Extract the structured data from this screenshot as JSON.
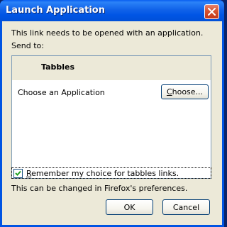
{
  "window": {
    "title": "Launch Application"
  },
  "message": "This link needs to be opened with an application.",
  "send_to_label": "Send to:",
  "handler": {
    "name": "Tabbles",
    "choose_app_label": "Choose an Application",
    "choose_button": {
      "before": "",
      "mnemonic": "C",
      "after": "hoose..."
    }
  },
  "remember": {
    "checked": true,
    "before": "",
    "mnemonic": "R",
    "after": "emember my choice for tabbles links."
  },
  "hint": "This can be changed in Firefox's preferences.",
  "buttons": {
    "ok": "OK",
    "cancel": "Cancel"
  },
  "colors": {
    "titlebar": "#0054e3",
    "dialog_bg": "#ece9d8",
    "close_button": "#d6522f",
    "check_mark": "#21a121"
  },
  "icons": {
    "close": "close-icon",
    "check": "checkmark-icon"
  }
}
